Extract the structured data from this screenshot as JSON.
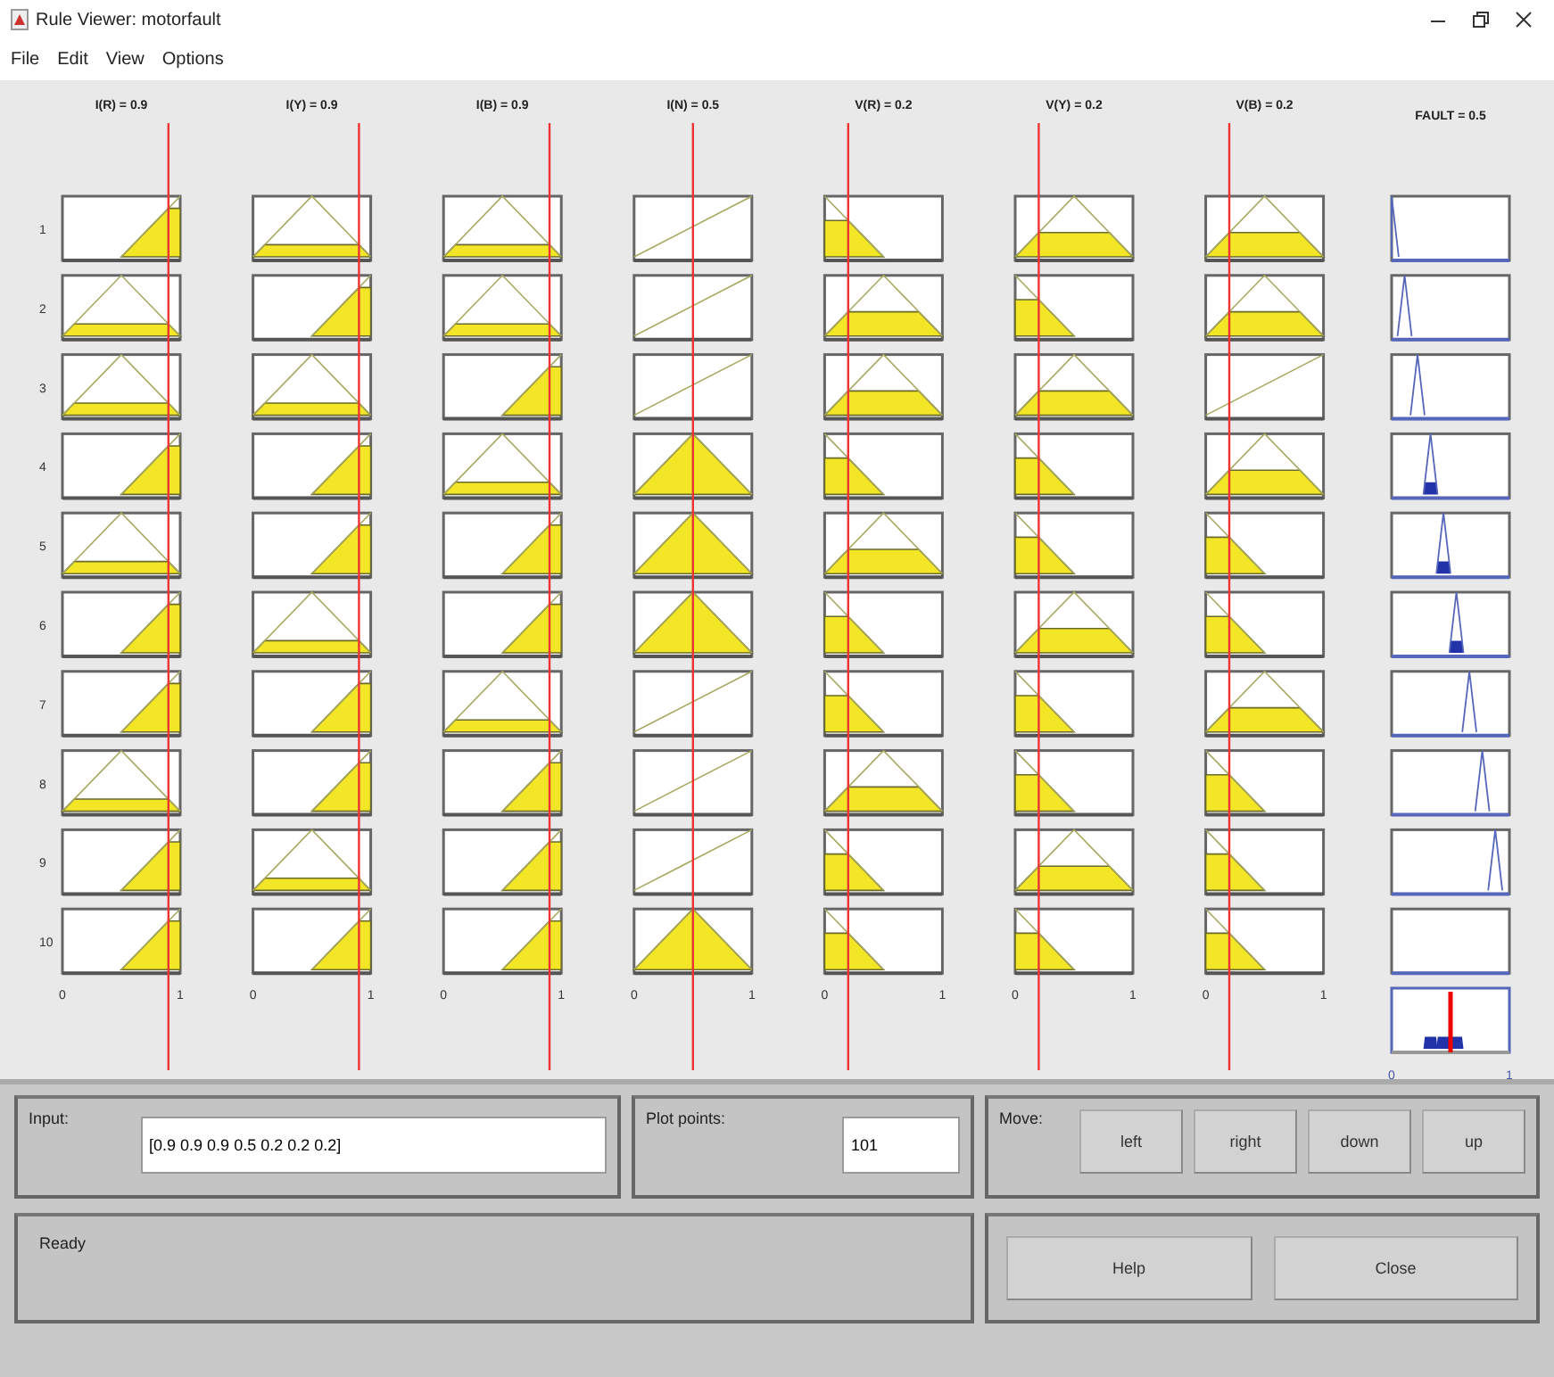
{
  "window": {
    "title": "Rule Viewer: motorfault"
  },
  "menu": [
    "File",
    "Edit",
    "View",
    "Options"
  ],
  "rule_numbers": [
    "1",
    "2",
    "3",
    "4",
    "5",
    "6",
    "7",
    "8",
    "9",
    "10"
  ],
  "inputs": [
    {
      "header": "I(R) = 0.9",
      "axis": [
        "0",
        "1"
      ],
      "rules": [
        {
          "kind": "rise"
        },
        {
          "kind": "tri"
        },
        {
          "kind": "tri"
        },
        {
          "kind": "rise"
        },
        {
          "kind": "tri"
        },
        {
          "kind": "rise"
        },
        {
          "kind": "rise"
        },
        {
          "kind": "tri"
        },
        {
          "kind": "rise"
        },
        {
          "kind": "rise"
        }
      ]
    },
    {
      "header": "I(Y) = 0.9",
      "axis": [
        "0",
        "1"
      ],
      "rules": [
        {
          "kind": "tri"
        },
        {
          "kind": "rise"
        },
        {
          "kind": "tri"
        },
        {
          "kind": "rise"
        },
        {
          "kind": "rise"
        },
        {
          "kind": "tri"
        },
        {
          "kind": "rise"
        },
        {
          "kind": "rise"
        },
        {
          "kind": "tri"
        },
        {
          "kind": "rise"
        }
      ]
    },
    {
      "header": "I(B) = 0.9",
      "axis": [
        "0",
        "1"
      ],
      "rules": [
        {
          "kind": "tri"
        },
        {
          "kind": "tri"
        },
        {
          "kind": "rise"
        },
        {
          "kind": "tri"
        },
        {
          "kind": "rise"
        },
        {
          "kind": "rise"
        },
        {
          "kind": "tri"
        },
        {
          "kind": "rise"
        },
        {
          "kind": "rise"
        },
        {
          "kind": "rise"
        }
      ]
    },
    {
      "header": "I(N) = 0.5",
      "axis": [
        "0",
        "1"
      ],
      "rules": [
        {
          "kind": "line"
        },
        {
          "kind": "line"
        },
        {
          "kind": "line"
        },
        {
          "kind": "tri"
        },
        {
          "kind": "tri"
        },
        {
          "kind": "tri"
        },
        {
          "kind": "line"
        },
        {
          "kind": "line"
        },
        {
          "kind": "line"
        },
        {
          "kind": "tri"
        }
      ]
    },
    {
      "header": "V(R) = 0.2",
      "axis": [
        "0",
        "1"
      ],
      "rules": [
        {
          "kind": "fall"
        },
        {
          "kind": "tri"
        },
        {
          "kind": "tri"
        },
        {
          "kind": "fall"
        },
        {
          "kind": "tri"
        },
        {
          "kind": "fall"
        },
        {
          "kind": "fall"
        },
        {
          "kind": "tri"
        },
        {
          "kind": "fall"
        },
        {
          "kind": "fall"
        }
      ]
    },
    {
      "header": "V(Y) = 0.2",
      "axis": [
        "0",
        "1"
      ],
      "rules": [
        {
          "kind": "tri"
        },
        {
          "kind": "fall"
        },
        {
          "kind": "tri"
        },
        {
          "kind": "fall"
        },
        {
          "kind": "fall"
        },
        {
          "kind": "tri"
        },
        {
          "kind": "fall"
        },
        {
          "kind": "fall"
        },
        {
          "kind": "tri"
        },
        {
          "kind": "fall"
        }
      ]
    },
    {
      "header": "V(B) = 0.2",
      "axis": [
        "0",
        "1"
      ],
      "rules": [
        {
          "kind": "tri"
        },
        {
          "kind": "tri"
        },
        {
          "kind": "line"
        },
        {
          "kind": "tri"
        },
        {
          "kind": "fall"
        },
        {
          "kind": "fall"
        },
        {
          "kind": "tri"
        },
        {
          "kind": "fall"
        },
        {
          "kind": "fall"
        },
        {
          "kind": "fall"
        }
      ]
    }
  ],
  "output": {
    "header": "FAULT = 0.5",
    "axis": [
      "0",
      "1"
    ],
    "rules": [
      {
        "kind": "tri"
      },
      {
        "kind": "tri"
      },
      {
        "kind": "tri"
      },
      {
        "kind": "tri"
      },
      {
        "kind": "tri"
      },
      {
        "kind": "tri"
      },
      {
        "kind": "tri"
      },
      {
        "kind": "tri"
      },
      {
        "kind": "tri"
      },
      {
        "kind": "empty"
      }
    ]
  },
  "input_panel": {
    "label": "Input:",
    "value": "[0.9 0.9 0.9 0.5 0.2 0.2 0.2]"
  },
  "plot_points": {
    "label": "Plot points:",
    "value": "101"
  },
  "move": {
    "label": "Move:",
    "buttons": [
      "left",
      "right",
      "down",
      "up"
    ]
  },
  "status": "Ready",
  "buttons": [
    "Help",
    "Close"
  ]
}
